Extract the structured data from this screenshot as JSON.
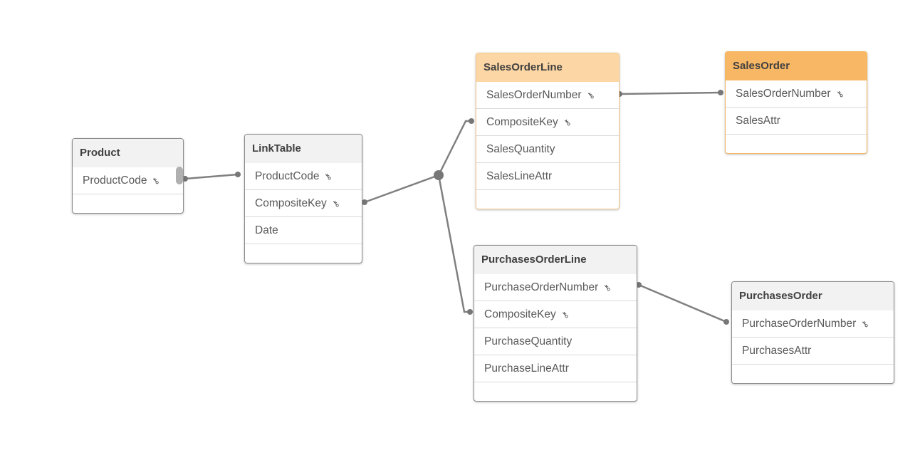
{
  "tables": [
    {
      "name": "Product",
      "header_color": "#f2f2f2",
      "fields": [
        {
          "label": "ProductCode",
          "key": true
        }
      ]
    },
    {
      "name": "LinkTable",
      "header_color": "#f2f2f2",
      "fields": [
        {
          "label": "ProductCode",
          "key": true
        },
        {
          "label": "CompositeKey",
          "key": true
        },
        {
          "label": "Date",
          "key": false
        }
      ]
    },
    {
      "name": "SalesOrderLine",
      "header_color": "#fcd6a4",
      "fields": [
        {
          "label": "SalesOrderNumber",
          "key": true
        },
        {
          "label": "CompositeKey",
          "key": true
        },
        {
          "label": "SalesQuantity",
          "key": false
        },
        {
          "label": "SalesLineAttr",
          "key": false
        }
      ]
    },
    {
      "name": "SalesOrder",
      "header_color": "#f8b764",
      "fields": [
        {
          "label": "SalesOrderNumber",
          "key": true
        },
        {
          "label": "SalesAttr",
          "key": false
        }
      ]
    },
    {
      "name": "PurchasesOrderLine",
      "header_color": "#f2f2f2",
      "fields": [
        {
          "label": "PurchaseOrderNumber",
          "key": true
        },
        {
          "label": "CompositeKey",
          "key": true
        },
        {
          "label": "PurchaseQuantity",
          "key": false
        },
        {
          "label": "PurchaseLineAttr",
          "key": false
        }
      ]
    },
    {
      "name": "PurchasesOrder",
      "header_color": "#f2f2f2",
      "fields": [
        {
          "label": "PurchaseOrderNumber",
          "key": true
        },
        {
          "label": "PurchasesAttr",
          "key": false
        }
      ]
    }
  ],
  "links": [
    {
      "from": "Product.ProductCode",
      "to": "LinkTable.ProductCode"
    },
    {
      "from": "LinkTable.CompositeKey",
      "to": "SalesOrderLine.CompositeKey"
    },
    {
      "from": "LinkTable.CompositeKey",
      "to": "PurchasesOrderLine.CompositeKey"
    },
    {
      "from": "SalesOrderLine.SalesOrderNumber",
      "to": "SalesOrder.SalesOrderNumber"
    },
    {
      "from": "PurchasesOrderLine.PurchaseOrderNumber",
      "to": "PurchasesOrder.PurchaseOrderNumber"
    }
  ],
  "key_icon": "key-icon",
  "link_color": "#808080"
}
